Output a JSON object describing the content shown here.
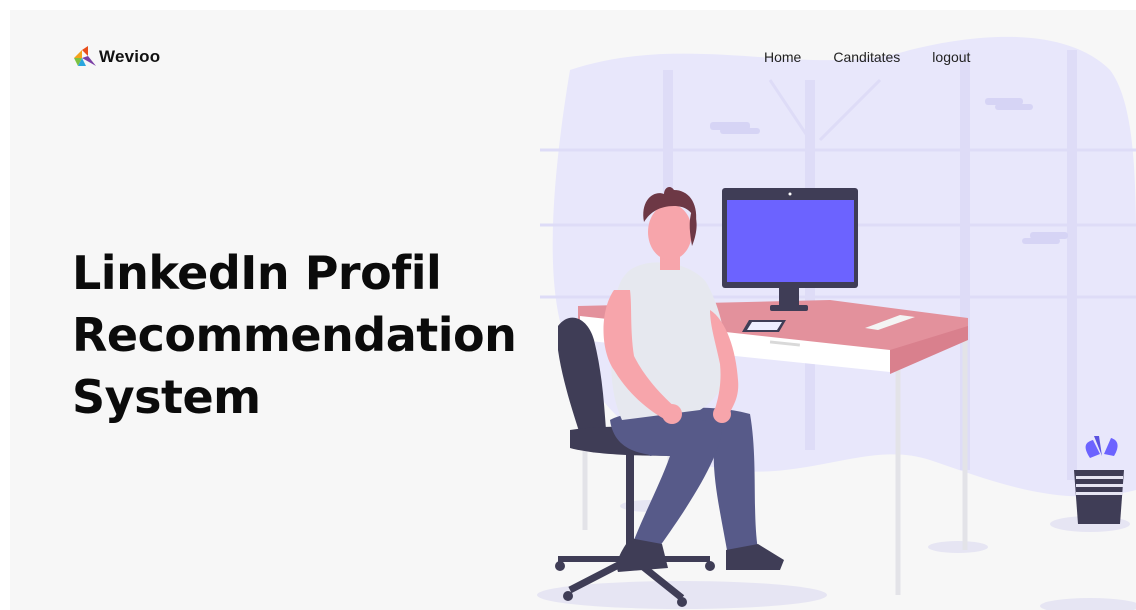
{
  "brand": {
    "name": "Wevioo"
  },
  "nav": {
    "items": [
      {
        "label": "Home"
      },
      {
        "label": "Canditates"
      },
      {
        "label": "logout"
      }
    ]
  },
  "hero": {
    "lines": [
      "LinkedIn Profil",
      "Recommendation",
      "System"
    ]
  },
  "colors": {
    "background": "#f7f7f7",
    "blob": "#e8e7fb",
    "monitor_screen": "#6c63ff",
    "desk": "#e3919c",
    "pants": "#575a89",
    "chair": "#3f3d56",
    "text": "#0b0b0b"
  },
  "icons": [
    "wevioo-logo-icon"
  ]
}
